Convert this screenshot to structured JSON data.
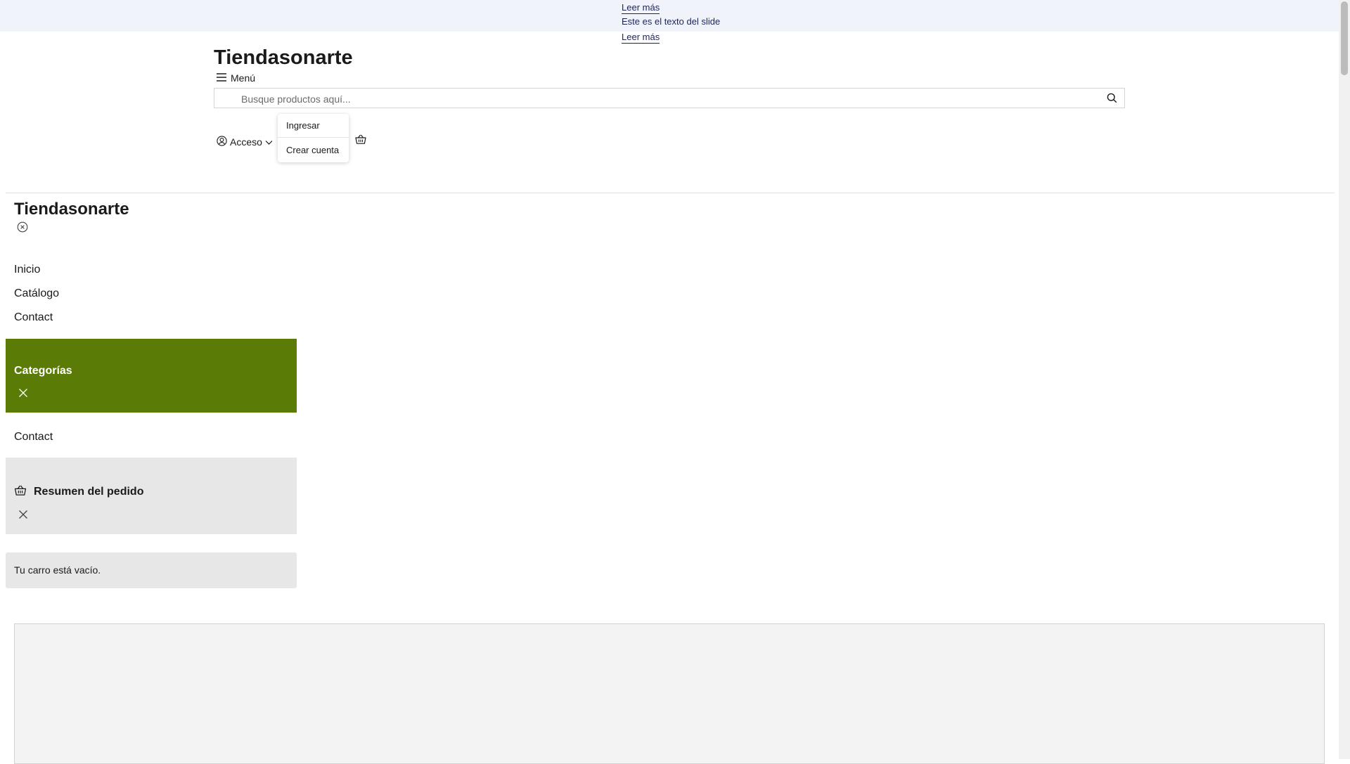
{
  "announcement": {
    "link_top": "Leer más",
    "slide_text": "Este es el texto del slide",
    "link_bottom": "Leer más"
  },
  "header": {
    "brand": "Tiendasonarte",
    "menu_label": "Menú",
    "search": {
      "placeholder": "Busque productos aquí..."
    },
    "account_label": "Acceso",
    "account_menu": {
      "login": "Ingresar",
      "create_account": "Crear cuenta"
    }
  },
  "side_menu": {
    "brand": "Tiendasonarte",
    "links": [
      "Inicio",
      "Catálogo",
      "Contact"
    ]
  },
  "categories": {
    "title": "Categorías",
    "links": [
      "Contact"
    ]
  },
  "order_summary": {
    "title": "Resumen del pedido",
    "empty_message": "Tu carro está vacío."
  },
  "colors": {
    "accent_green": "#5b7b07",
    "panel_gray": "#e7e7e7",
    "announce_bg": "#f1f3fb",
    "announce_text": "#1d2358"
  },
  "icons": {
    "menu": "hamburger-icon",
    "search": "search-icon",
    "account": "user-circle-icon",
    "chevron": "chevron-down-icon",
    "cart": "basket-icon",
    "close_circle": "close-circle-icon",
    "close": "close-icon"
  }
}
